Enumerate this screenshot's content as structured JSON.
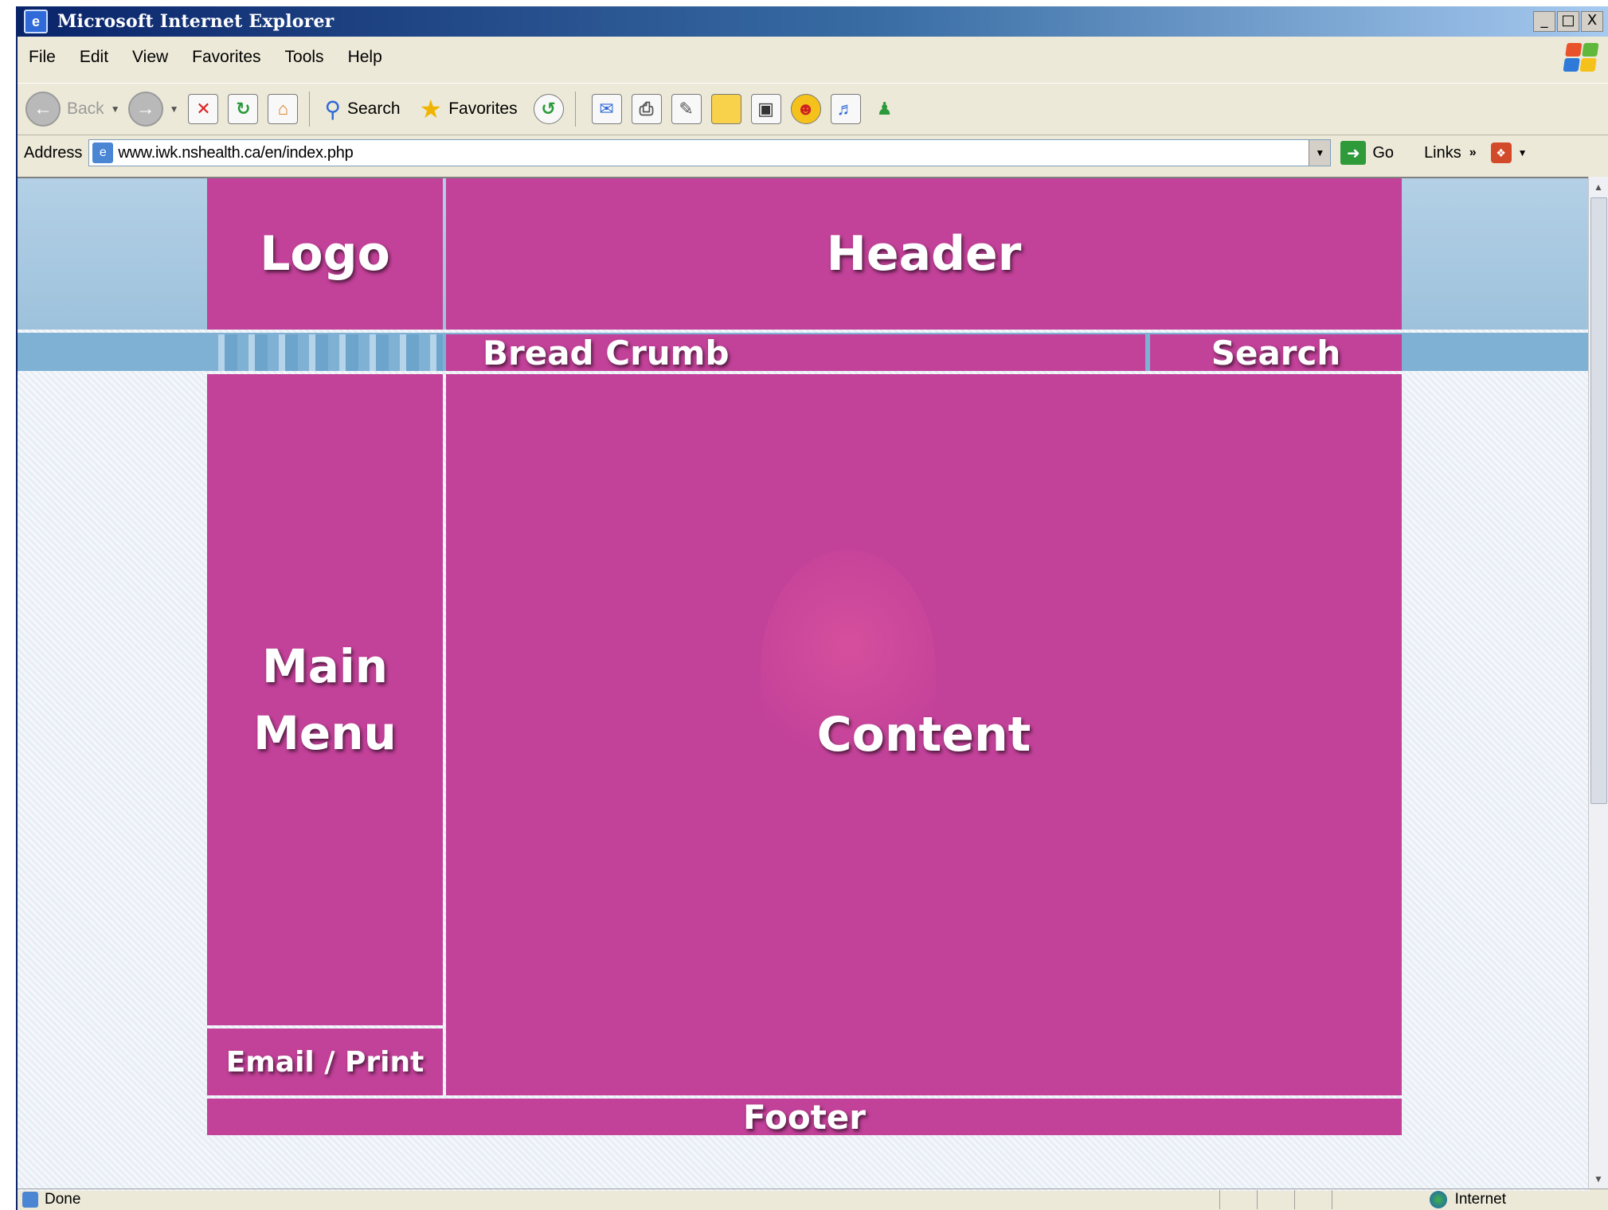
{
  "window": {
    "title": "Microsoft Internet Explorer",
    "controls": [
      "_",
      "□",
      "X"
    ]
  },
  "menu": [
    "File",
    "Edit",
    "View",
    "Favorites",
    "Tools",
    "Help"
  ],
  "toolbar": {
    "back_label": "Back",
    "search_label": "Search",
    "favorites_label": "Favorites"
  },
  "address": {
    "label": "Address",
    "url": "www.iwk.nshealth.ca/en/index.php",
    "go_label": "Go",
    "links_label": "Links"
  },
  "wireframe": {
    "logo": "Logo",
    "header": "Header",
    "breadcrumb": "Bread Crumb",
    "search": "Search",
    "main_menu": [
      "Main",
      "Menu"
    ],
    "content": "Content",
    "email_print": "Email / Print",
    "footer": "Footer"
  },
  "status": {
    "text": "Done",
    "zone": "Internet"
  },
  "colors": {
    "wireframe_fill": "#c24199",
    "page_blue": "#7fb1d5"
  }
}
